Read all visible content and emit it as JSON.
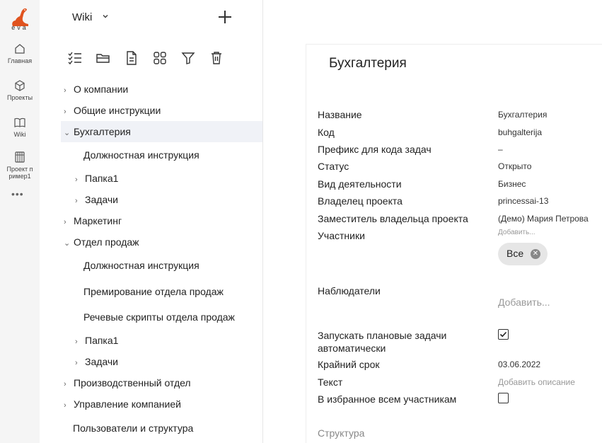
{
  "rail": {
    "logo_text": "eva",
    "items": [
      {
        "label": "Главная",
        "icon": "home-icon"
      },
      {
        "label": "Проекты",
        "icon": "cube-icon"
      },
      {
        "label": "Wiki",
        "icon": "book-icon"
      },
      {
        "label": "Проект п ример1",
        "icon": "project-icon"
      }
    ],
    "more": "•••"
  },
  "tree": {
    "space_title": "Wiki",
    "toolbar_icons": [
      "checklist-icon",
      "folder-icon",
      "document-icon",
      "grid-icon",
      "filter-icon",
      "trash-icon"
    ],
    "nodes": [
      {
        "label": "О компании",
        "chev": "›",
        "level": 0
      },
      {
        "label": "Общие инструкции",
        "chev": "›",
        "level": 0
      },
      {
        "label": "Бухгалтерия",
        "chev": "⌄",
        "level": 0,
        "selected": true
      },
      {
        "label": "Должностная инструкция",
        "chev": "",
        "level": 2
      },
      {
        "label": "Папка1",
        "chev": "›",
        "level": 1
      },
      {
        "label": "Задачи",
        "chev": "›",
        "level": 1
      },
      {
        "label": "Маркетинг",
        "chev": "›",
        "level": 0
      },
      {
        "label": "Отдел продаж",
        "chev": "⌄",
        "level": 0
      },
      {
        "label": "Должностная инструкция",
        "chev": "",
        "level": 2
      },
      {
        "label": "Премирование отдела продаж",
        "chev": "",
        "level": 2
      },
      {
        "label": "Речевые скрипты отдела продаж",
        "chev": "",
        "level": 2
      },
      {
        "label": "Папка1",
        "chev": "›",
        "level": 1
      },
      {
        "label": "Задачи",
        "chev": "›",
        "level": 1
      },
      {
        "label": "Производственный отдел",
        "chev": "›",
        "level": 0
      },
      {
        "label": "Управление компанией",
        "chev": "›",
        "level": 0
      },
      {
        "label": "Пользователи и структура",
        "chev": "",
        "level": 0
      }
    ]
  },
  "details": {
    "title": "Бухгалтерия",
    "fields": {
      "name_label": "Название",
      "name_value": "Бухгалтерия",
      "code_label": "Код",
      "code_value": "buhgalterija",
      "prefix_label": "Префикс для кода задач",
      "prefix_value": "–",
      "status_label": "Статус",
      "status_value": "Открыто",
      "activity_label": "Вид деятельности",
      "activity_value": "Бизнес",
      "owner_label": "Владелец проекта",
      "owner_value": "princessai-13",
      "deputy_label": "Заместитель владельца проекта",
      "deputy_value": "(Демо) Мария Петрова",
      "members_label": "Участники",
      "members_add": "Добавить...",
      "members_chip": "Все",
      "observers_label": "Наблюдатели",
      "observers_add": "Добавить...",
      "autorun_label": "Запускать плановые задачи автоматически",
      "autorun_checked": true,
      "deadline_label": "Крайний срок",
      "deadline_value": "03.06.2022",
      "text_label": "Текст",
      "text_add": "Добавить описание",
      "favorite_label": "В избранное всем участникам",
      "favorite_checked": false
    },
    "section_structure": "Структура"
  },
  "colors": {
    "accent": "#e0531f",
    "selected_bg": "#f0f2f7",
    "rail_bg": "#f5f5f5"
  }
}
